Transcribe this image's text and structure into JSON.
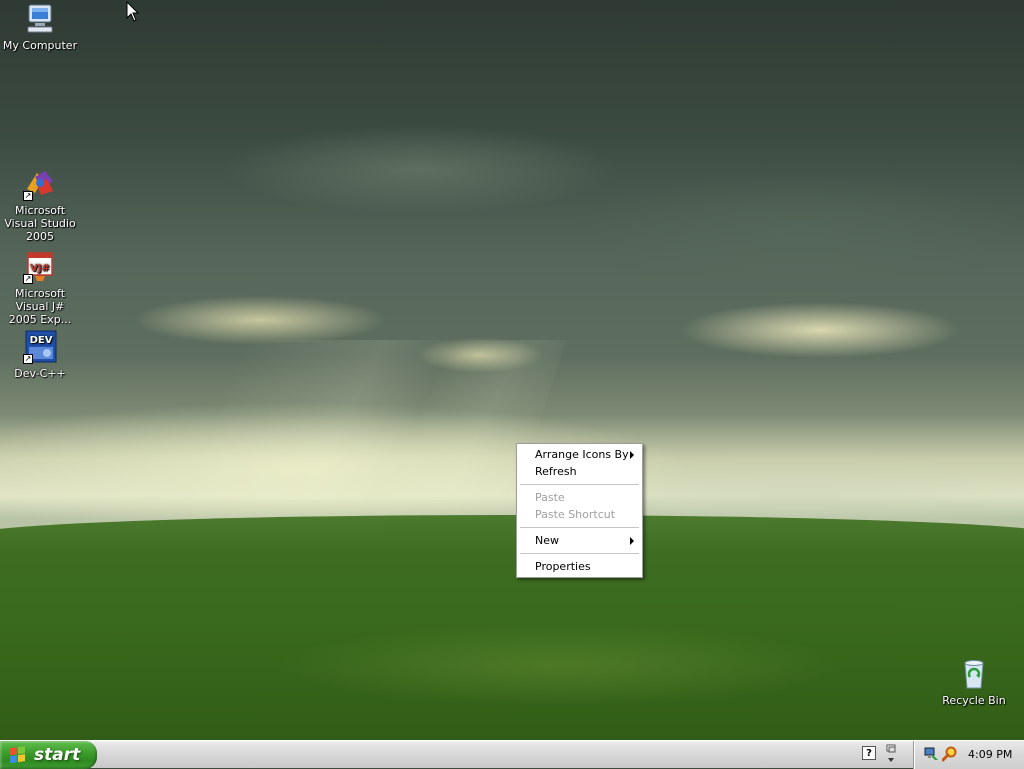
{
  "desktop": {
    "icons": [
      {
        "label": "My Computer"
      },
      {
        "label": "Microsoft Visual Studio 2005"
      },
      {
        "label": "Microsoft Visual J# 2005 Exp..."
      },
      {
        "label": "Dev-C++"
      },
      {
        "label": "Recycle Bin"
      }
    ],
    "vj_badge": "VJ#",
    "dev_badge": "DEV"
  },
  "context_menu": {
    "items": [
      {
        "label": "Arrange Icons By",
        "submenu": true,
        "enabled": true
      },
      {
        "label": "Refresh",
        "enabled": true
      },
      {
        "label": "Paste",
        "enabled": false
      },
      {
        "label": "Paste Shortcut",
        "enabled": false
      },
      {
        "label": "New",
        "submenu": true,
        "enabled": true
      },
      {
        "label": "Properties",
        "enabled": true
      }
    ]
  },
  "taskbar": {
    "start_label": "start",
    "help_glyph": "?",
    "clock": "4:09 PM"
  },
  "colors": {
    "start_green": "#3c9a2a",
    "menu_disabled": "#a0a0a0"
  }
}
